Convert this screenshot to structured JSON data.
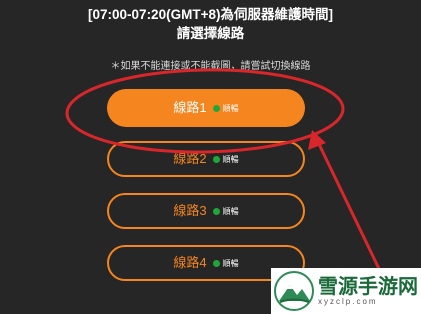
{
  "header": {
    "title": "[07:00-07:20(GMT+8)為伺服器維護時間]",
    "subtitle": "請選擇線路"
  },
  "notice": "＊如果不能連接或不能截圖，請嘗試切換線路",
  "routes": [
    {
      "name": "線路1",
      "status": "順暢"
    },
    {
      "name": "線路2",
      "status": "順暢"
    },
    {
      "name": "線路3",
      "status": "順暢"
    },
    {
      "name": "線路4",
      "status": "順暢"
    }
  ],
  "watermark": {
    "main": "雪源手游网",
    "sub": "xyzclp.com"
  },
  "colors": {
    "background": "#262626",
    "accent": "#f5851f",
    "status_ok": "#1fa83a",
    "annotation": "#d9262b"
  },
  "selected_route_index": 0
}
